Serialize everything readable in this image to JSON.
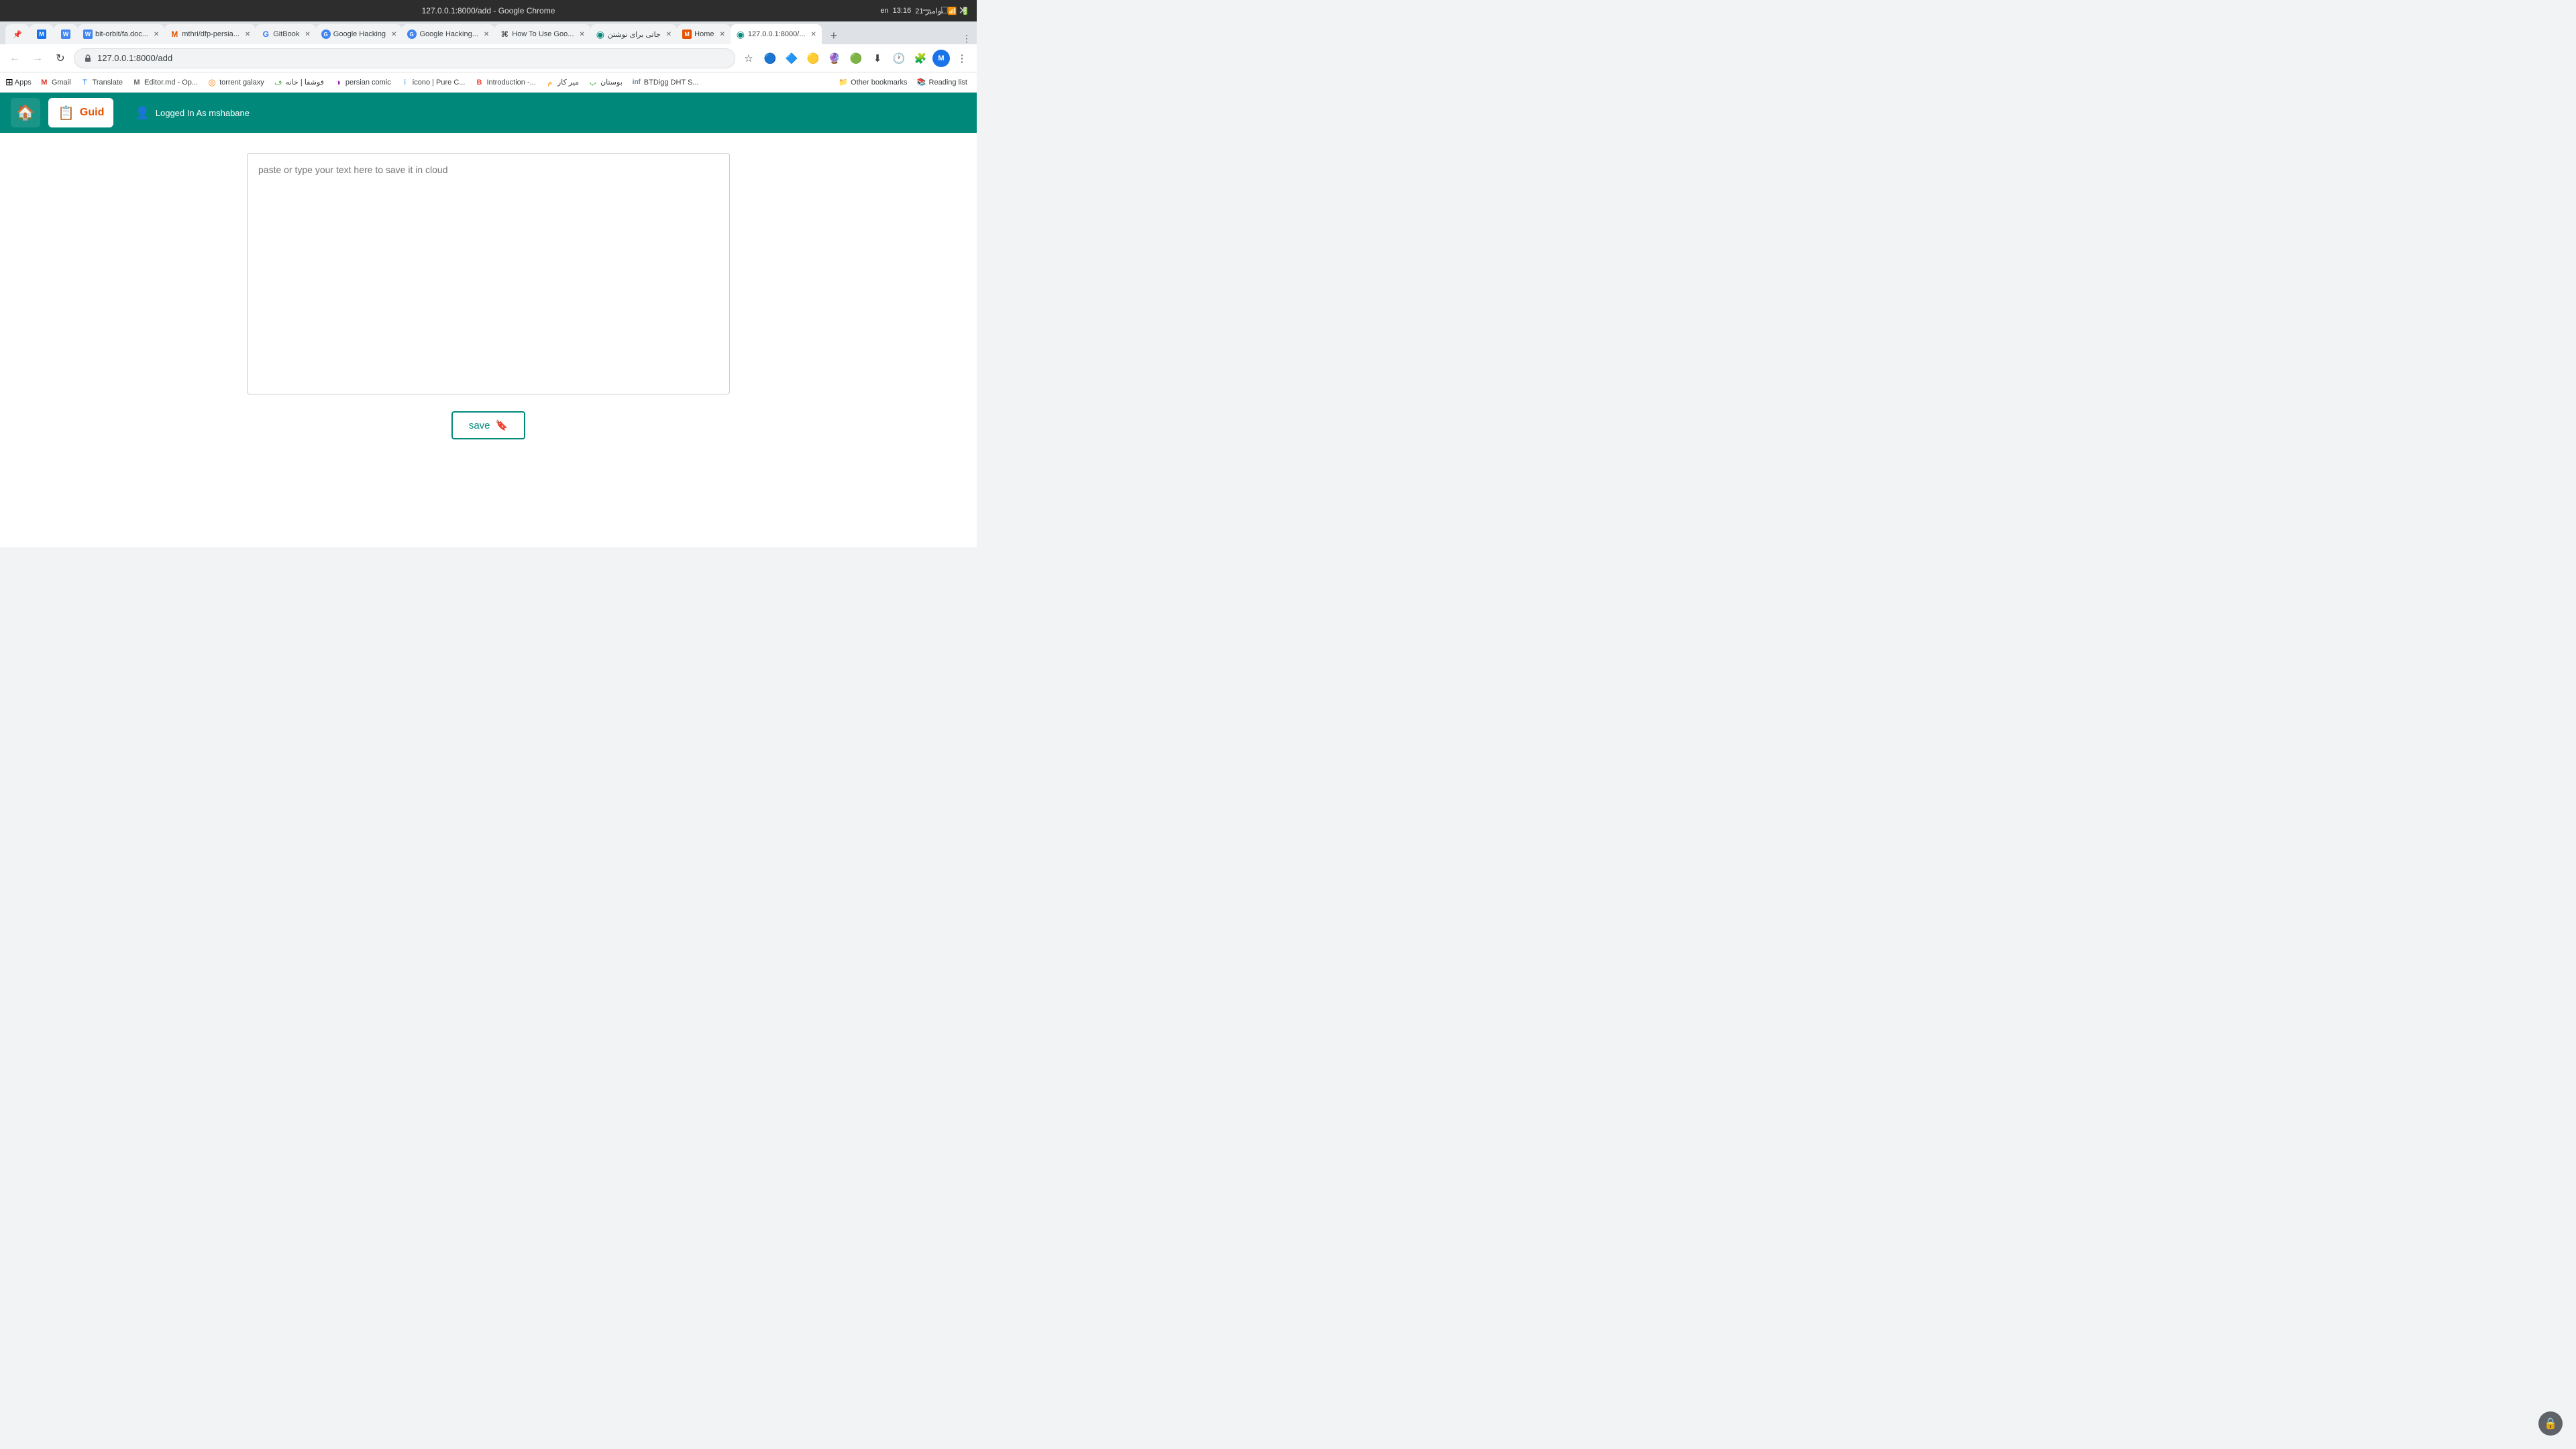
{
  "titleBar": {
    "title": "127.0.0.1:8000/add - Google Chrome",
    "minimize": "─",
    "maximize": "□",
    "close": "✕"
  },
  "systemTray": {
    "time": "13:16",
    "date": "21 نوامبر",
    "lang": "en"
  },
  "tabs": [
    {
      "id": "tab1",
      "label": "",
      "favicon": "📌",
      "active": false,
      "closable": false
    },
    {
      "id": "tab2",
      "label": "",
      "favicon": "M",
      "active": false,
      "closable": false
    },
    {
      "id": "tab3",
      "label": "",
      "favicon": "W",
      "active": false,
      "closable": false
    },
    {
      "id": "tab4",
      "label": "bit-orbit/fa.doc...",
      "favicon": "W",
      "active": false,
      "closable": true
    },
    {
      "id": "tab5",
      "label": "mthri/dfp-persia...",
      "favicon": "M",
      "active": false,
      "closable": true
    },
    {
      "id": "tab6",
      "label": "GitBook",
      "favicon": "G",
      "active": false,
      "closable": true
    },
    {
      "id": "tab7",
      "label": "Google Hacking",
      "favicon": "G",
      "active": false,
      "closable": true
    },
    {
      "id": "tab8",
      "label": "Google Hacking...",
      "favicon": "G",
      "active": false,
      "closable": true
    },
    {
      "id": "tab9",
      "label": "How To Use Goo...",
      "favicon": "⌘",
      "active": false,
      "closable": true
    },
    {
      "id": "tab10",
      "label": "جاتی برای نوشتن",
      "favicon": "◉",
      "active": false,
      "closable": true
    },
    {
      "id": "tab11",
      "label": "Home",
      "favicon": "M",
      "active": false,
      "closable": true
    },
    {
      "id": "tab12",
      "label": "127.0.0.1:8000/...",
      "favicon": "◉",
      "active": true,
      "closable": true
    }
  ],
  "navBar": {
    "backDisabled": true,
    "forwardDisabled": true,
    "address": "127.0.0.1:8000/add",
    "secure": true
  },
  "bookmarks": {
    "appsLabel": "Apps",
    "items": [
      {
        "label": "Gmail",
        "favicon": "M",
        "color": "#d93025"
      },
      {
        "label": "Translate",
        "favicon": "T",
        "color": "#1a73e8"
      },
      {
        "label": "Editor.md - Op...",
        "favicon": "M",
        "color": "#666"
      },
      {
        "label": "torrent galaxy",
        "favicon": "◎",
        "color": "#f57c00"
      },
      {
        "label": "فوشفا | خانه",
        "favicon": "ف",
        "color": "#4caf50"
      },
      {
        "label": "persian comic",
        "favicon": "◑",
        "color": "#9c27b0"
      },
      {
        "label": "icono | Pure C...",
        "favicon": "i",
        "color": "#2196f3"
      },
      {
        "label": "Introduction -...",
        "favicon": "B",
        "color": "#f44336"
      },
      {
        "label": "میر کار",
        "favicon": "م",
        "color": "#ff9800"
      },
      {
        "label": "بوستان",
        "favicon": "ب",
        "color": "#4caf50"
      },
      {
        "label": "BTDigg DHT S...",
        "favicon": "inf",
        "color": "#607d8b"
      }
    ],
    "right": [
      {
        "label": "Other bookmarks",
        "isFolder": true
      },
      {
        "label": "Reading list",
        "isFolder": true
      }
    ]
  },
  "appHeader": {
    "homeLabel": "🏠",
    "guidLabel": "Guid",
    "guidIcon": "📋",
    "userIcon": "👤",
    "userText": "Logged In As mshabane"
  },
  "main": {
    "textareaPlaceholder": "paste or type your text here to save it in cloud",
    "saveLabel": "save",
    "saveIcon": "🔖"
  },
  "lockIcon": "🔒"
}
